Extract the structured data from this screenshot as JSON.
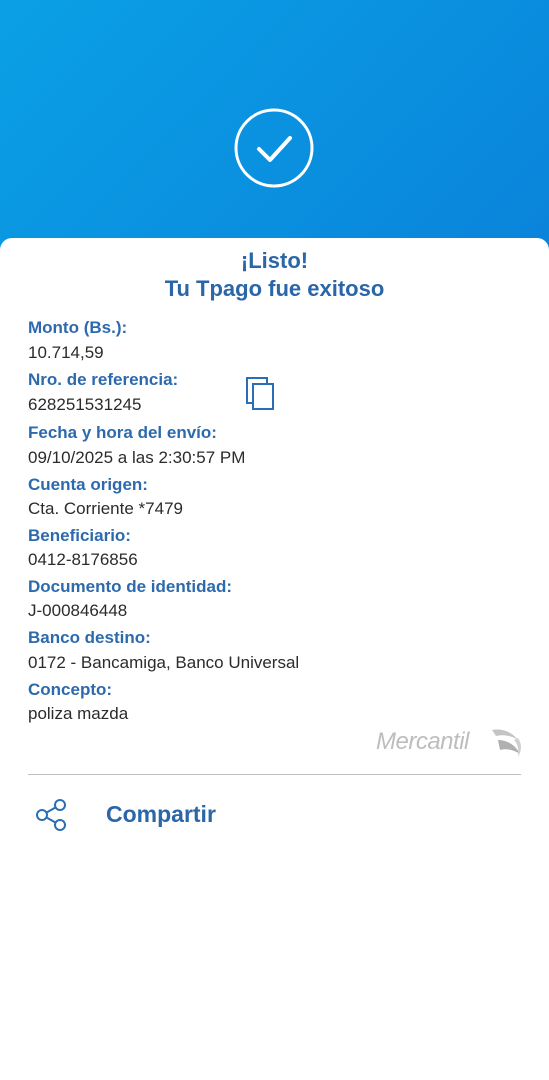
{
  "header": {
    "success_icon": "check-circle-icon"
  },
  "card": {
    "title_line1": "¡Listo!",
    "title_line2": "Tu Tpago fue exitoso",
    "fields": [
      {
        "label": "Monto (Bs.):",
        "value": "10.714,59"
      },
      {
        "label": "Nro. de referencia:",
        "value": "628251531245"
      },
      {
        "label": "Fecha y hora del envío:",
        "value": "09/10/2025 a las 2:30:57 PM"
      },
      {
        "label": "Cuenta origen:",
        "value": "Cta. Corriente *7479"
      },
      {
        "label": "Beneficiario:",
        "value": "0412-8176856"
      },
      {
        "label": "Documento de identidad:",
        "value": "J-000846448"
      },
      {
        "label": "Banco destino:",
        "value": "0172 - Bancamiga, Banco Universal"
      },
      {
        "label": "Concepto:",
        "value": "poliza mazda"
      }
    ],
    "copy_icon": "copy-icon",
    "logo_text": "Mercantil"
  },
  "share": {
    "icon": "share-icon",
    "label": "Compartir"
  },
  "colors": {
    "gradient_start": "#0aa0e6",
    "gradient_end": "#0563cf",
    "label_blue": "#2d6aad",
    "value_text": "#2b2b2b",
    "logo_gray": "#bdbdbd"
  }
}
